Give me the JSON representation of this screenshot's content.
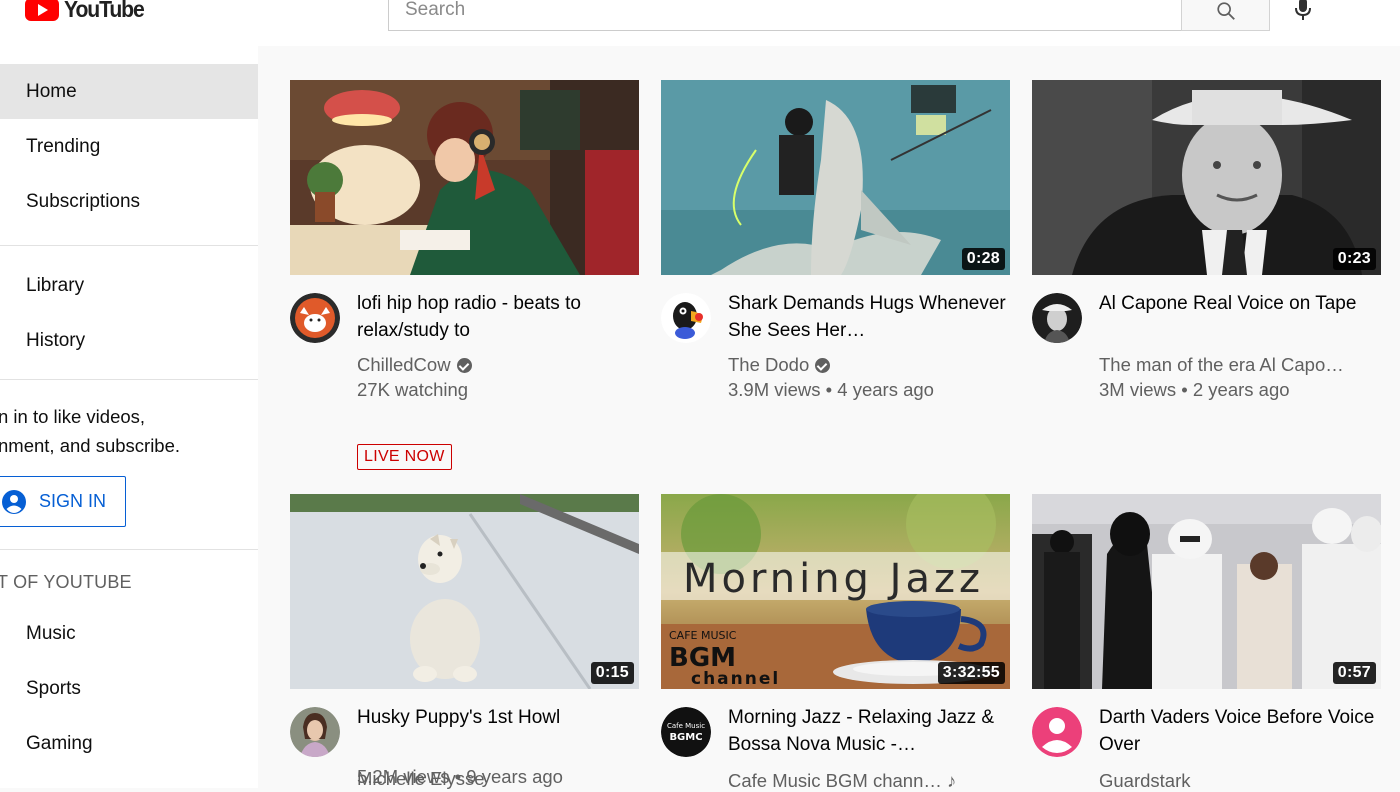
{
  "header": {
    "logo_text": "YouTube",
    "search_placeholder": "Search"
  },
  "sidebar": {
    "nav": [
      {
        "label": "Home",
        "active": true
      },
      {
        "label": "Trending",
        "active": false
      },
      {
        "label": "Subscriptions",
        "active": false
      }
    ],
    "library": [
      {
        "label": "Library"
      },
      {
        "label": "History"
      }
    ],
    "signin_text_line1": "n in to like videos,",
    "signin_text_line2": "nment, and subscribe.",
    "signin_button": "SIGN IN",
    "best_of_header": "T OF YOUTUBE",
    "best_of": [
      {
        "label": "Music"
      },
      {
        "label": "Sports"
      },
      {
        "label": "Gaming"
      }
    ]
  },
  "videos": [
    {
      "title": "lofi hip hop radio - beats to relax/study to",
      "channel": "ChilledCow",
      "verified": true,
      "meta": "27K watching",
      "badge": "LIVE NOW",
      "duration": ""
    },
    {
      "title": "Shark Demands Hugs Whenever She Sees Her…",
      "channel": "The Dodo",
      "verified": true,
      "meta": "3.9M views • 4 years ago",
      "duration": "0:28"
    },
    {
      "title": "Al Capone Real Voice on Tape",
      "channel": "The man of the era Al Capo…",
      "verified": false,
      "meta": "3M views • 2 years ago",
      "duration": "0:23"
    },
    {
      "title": "Husky Puppy's 1st Howl",
      "channel": "Michelle Elysse",
      "verified": false,
      "meta": "5.2M views • 9 years ago",
      "duration": "0:15"
    },
    {
      "title": "Morning Jazz - Relaxing Jazz & Bossa Nova Music -…",
      "channel": "Cafe Music BGM chann… ♪",
      "verified": false,
      "meta": "",
      "duration": "3:32:55",
      "thumb_text_main": "Morning Jazz",
      "thumb_text_small": "CAFE MUSIC",
      "thumb_text_bgm": "BGM",
      "thumb_text_channel": "channel",
      "avatar_text_1": "Cafe Music",
      "avatar_text_2": "BGMC"
    },
    {
      "title": "Darth Vaders Voice Before Voice Over",
      "channel": "Guardstark",
      "verified": false,
      "meta": "",
      "duration": "0:57"
    }
  ]
}
